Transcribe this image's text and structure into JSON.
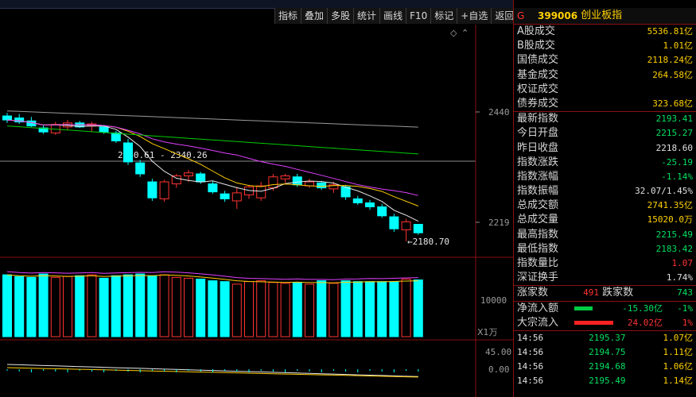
{
  "toolbar": [
    "指标",
    "叠加",
    "多股",
    "统计",
    "画线",
    "F10",
    "标记",
    "+自选",
    "返回"
  ],
  "chart": {
    "price_ticks": [
      "2440",
      "2219"
    ],
    "volume_tick": "10000",
    "volume_unit": "X1万",
    "macd_ticks": [
      "45.00",
      "0.00"
    ],
    "annotation_high": "2340.61 - 2340.26",
    "annotation_low": "2180.70",
    "colors": {
      "up": "#ff3333",
      "down": "#00ffff",
      "ma5": "#e8e8e8",
      "ma10": "#ffcc00",
      "ma20": "#e040ff",
      "ma60": "#00cc00",
      "ma_long": "#9a9a9a"
    }
  },
  "chart_data": {
    "type": "candlestick",
    "y_ticks_shown": [
      2440,
      2219
    ],
    "candles": [
      {
        "open": 2432,
        "high": 2438,
        "low": 2418,
        "close": 2424
      },
      {
        "open": 2428,
        "high": 2436,
        "low": 2416,
        "close": 2420
      },
      {
        "open": 2422,
        "high": 2430,
        "low": 2410,
        "close": 2412
      },
      {
        "open": 2408,
        "high": 2414,
        "low": 2396,
        "close": 2400
      },
      {
        "open": 2398,
        "high": 2420,
        "low": 2394,
        "close": 2415
      },
      {
        "open": 2410,
        "high": 2424,
        "low": 2404,
        "close": 2418
      },
      {
        "open": 2418,
        "high": 2422,
        "low": 2408,
        "close": 2410
      },
      {
        "open": 2412,
        "high": 2420,
        "low": 2400,
        "close": 2416
      },
      {
        "open": 2410,
        "high": 2414,
        "low": 2396,
        "close": 2400
      },
      {
        "open": 2398,
        "high": 2402,
        "low": 2378,
        "close": 2382
      },
      {
        "open": 2378,
        "high": 2386,
        "low": 2334,
        "close": 2340
      },
      {
        "open": 2338,
        "high": 2344,
        "low": 2310,
        "close": 2316
      },
      {
        "open": 2300,
        "high": 2306,
        "low": 2262,
        "close": 2268
      },
      {
        "open": 2266,
        "high": 2304,
        "low": 2260,
        "close": 2300
      },
      {
        "open": 2296,
        "high": 2316,
        "low": 2288,
        "close": 2312
      },
      {
        "open": 2312,
        "high": 2324,
        "low": 2300,
        "close": 2318
      },
      {
        "open": 2316,
        "high": 2320,
        "low": 2296,
        "close": 2300
      },
      {
        "open": 2296,
        "high": 2302,
        "low": 2276,
        "close": 2280
      },
      {
        "open": 2276,
        "high": 2282,
        "low": 2260,
        "close": 2266
      },
      {
        "open": 2262,
        "high": 2290,
        "low": 2246,
        "close": 2278
      },
      {
        "open": 2274,
        "high": 2294,
        "low": 2266,
        "close": 2290
      },
      {
        "open": 2268,
        "high": 2300,
        "low": 2262,
        "close": 2292
      },
      {
        "open": 2288,
        "high": 2316,
        "low": 2282,
        "close": 2310
      },
      {
        "open": 2306,
        "high": 2316,
        "low": 2298,
        "close": 2312
      },
      {
        "open": 2310,
        "high": 2316,
        "low": 2290,
        "close": 2294
      },
      {
        "open": 2292,
        "high": 2306,
        "low": 2288,
        "close": 2300
      },
      {
        "open": 2298,
        "high": 2302,
        "low": 2284,
        "close": 2288
      },
      {
        "open": 2286,
        "high": 2300,
        "low": 2278,
        "close": 2294
      },
      {
        "open": 2290,
        "high": 2294,
        "low": 2264,
        "close": 2270
      },
      {
        "open": 2266,
        "high": 2272,
        "low": 2254,
        "close": 2258
      },
      {
        "open": 2258,
        "high": 2264,
        "low": 2244,
        "close": 2250
      },
      {
        "open": 2250,
        "high": 2256,
        "low": 2228,
        "close": 2232
      },
      {
        "open": 2230,
        "high": 2236,
        "low": 2200,
        "close": 2206
      },
      {
        "open": 2204,
        "high": 2226,
        "low": 2181,
        "close": 2220
      },
      {
        "open": 2215,
        "high": 2215,
        "low": 2194,
        "close": 2198
      }
    ],
    "volume": [
      7.3,
      7.1,
      7.0,
      7.4,
      7.0,
      7.1,
      7.2,
      7.3,
      6.9,
      7.2,
      7.3,
      7.4,
      7.2,
      7.3,
      7.0,
      6.9,
      6.8,
      6.6,
      6.5,
      6.2,
      6.5,
      6.6,
      6.4,
      6.3,
      6.4,
      6.2,
      6.6,
      6.3,
      6.6,
      6.5,
      6.5,
      6.5,
      6.5,
      6.8,
      6.7
    ]
  },
  "panel": {
    "tag": "G",
    "code": "399006",
    "name": "创业板指",
    "rows1": [
      {
        "label": "A股成交",
        "value": "5536.81亿",
        "color": "y"
      },
      {
        "label": "B股成交",
        "value": "1.01亿",
        "color": "y"
      },
      {
        "label": "国债成交",
        "value": "2118.24亿",
        "color": "y"
      },
      {
        "label": "基金成交",
        "value": "264.58亿",
        "color": "y"
      },
      {
        "label": "权证成交",
        "value": "",
        "color": "y"
      },
      {
        "label": "债券成交",
        "value": "323.68亿",
        "color": "y"
      }
    ],
    "rows2": [
      {
        "label": "最新指数",
        "value": "2193.41",
        "color": "g"
      },
      {
        "label": "今日开盘",
        "value": "2215.27",
        "color": "g"
      },
      {
        "label": "昨日收盘",
        "value": "2218.60",
        "color": "w"
      },
      {
        "label": "指数涨跌",
        "value": "-25.19",
        "color": "g"
      },
      {
        "label": "指数涨幅",
        "value": "-1.14%",
        "color": "g"
      },
      {
        "label": "指数振幅",
        "value": "32.07/1.45%",
        "color": "w"
      },
      {
        "label": "总成交额",
        "value": "2741.35亿",
        "color": "y"
      },
      {
        "label": "总成交量",
        "value": "15020.0万",
        "color": "y"
      },
      {
        "label": "最高指数",
        "value": "2215.49",
        "color": "g"
      },
      {
        "label": "最低指数",
        "value": "2183.42",
        "color": "g"
      },
      {
        "label": "指数量比",
        "value": "1.07",
        "color": "r"
      },
      {
        "label": "深证换手",
        "value": "1.74%",
        "color": "w"
      }
    ],
    "updown": {
      "up_label": "涨家数",
      "up_value": "491",
      "down_label": "跌家数",
      "down_value": "743"
    },
    "flows": [
      {
        "label": "净流入额",
        "value": "-15.30亿",
        "pct": "-1%",
        "color": "g",
        "bar": "#00cc44",
        "bar_fraction": 0.45
      },
      {
        "label": "大宗流入",
        "value": "24.02亿",
        "pct": "1%",
        "color": "r",
        "bar": "#ff2222",
        "bar_fraction": 0.95
      }
    ],
    "ticks": [
      {
        "time": "14:56",
        "price": "2195.37",
        "vol": "1.07亿"
      },
      {
        "time": "14:56",
        "price": "2194.75",
        "vol": "1.11亿"
      },
      {
        "time": "14:56",
        "price": "2194.68",
        "vol": "1.06亿"
      },
      {
        "time": "14:56",
        "price": "2195.49",
        "vol": "1.14亿"
      }
    ]
  }
}
